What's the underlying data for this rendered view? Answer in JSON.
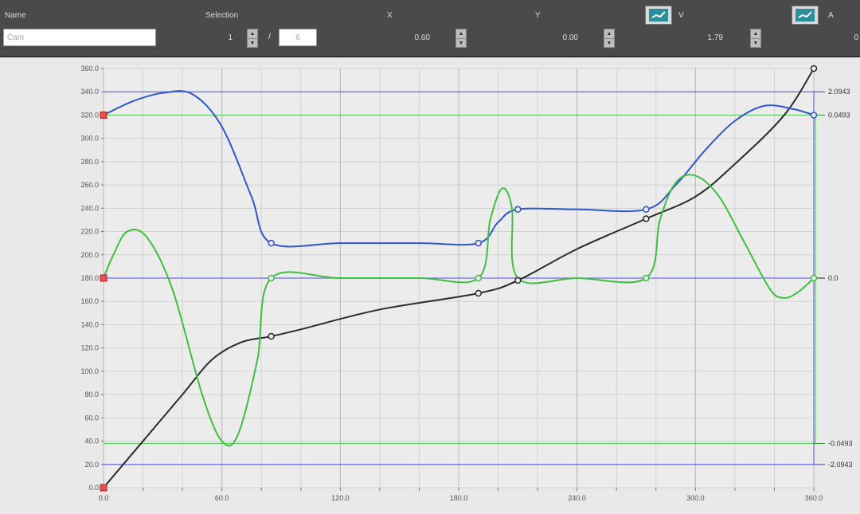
{
  "toolbar": {
    "name_label": "Name",
    "name_value": "Cam",
    "selection_label": "Selection",
    "selection_index": "1",
    "selection_total": "6",
    "x_label": "X",
    "x_value": "0.60",
    "y_label": "Y",
    "y_value": "0.00",
    "v_label": "V",
    "v_value": "1.79",
    "a_label": "A",
    "a_value": "0",
    "slash": "/"
  },
  "chart_data": {
    "type": "line",
    "xlim": [
      0,
      360
    ],
    "ylim": [
      0,
      360
    ],
    "x_ticks": [
      "0.0",
      "60.0",
      "120.0",
      "180.0",
      "240.0",
      "300.0",
      "360.0"
    ],
    "y_ticks": [
      "0.0",
      "20.0",
      "40.0",
      "60.0",
      "80.0",
      "100.0",
      "120.0",
      "140.0",
      "160.0",
      "180.0",
      "200.0",
      "220.0",
      "240.0",
      "260.0",
      "280.0",
      "300.0",
      "320.0",
      "340.0",
      "360.0"
    ],
    "right_labels": [
      {
        "text": "2.0943",
        "y": 340,
        "color": "blue"
      },
      {
        "text": "0.0493",
        "y": 320,
        "color": "green"
      },
      {
        "text": "0.0",
        "y": 180,
        "color": "black"
      },
      {
        "text": "-0.0493",
        "y": 38,
        "color": "green"
      },
      {
        "text": "-2.0943",
        "y": 20,
        "color": "blue"
      }
    ],
    "grid": true,
    "series": [
      {
        "key": "position",
        "color": "#2b2b2b",
        "points": [
          [
            0,
            0
          ],
          [
            20,
            40
          ],
          [
            40,
            80
          ],
          [
            55,
            110
          ],
          [
            70,
            125
          ],
          [
            85,
            130
          ],
          [
            100,
            136
          ],
          [
            140,
            153
          ],
          [
            190,
            167
          ],
          [
            210,
            178
          ],
          [
            240,
            205
          ],
          [
            275,
            231
          ],
          [
            300,
            250
          ],
          [
            320,
            278
          ],
          [
            345,
            320
          ],
          [
            360,
            360
          ]
        ],
        "markers": [
          [
            0,
            0
          ],
          [
            85,
            130
          ],
          [
            190,
            167
          ],
          [
            210,
            178
          ],
          [
            275,
            231
          ],
          [
            360,
            360
          ]
        ]
      },
      {
        "key": "velocity",
        "color": "#2e57c9",
        "points": [
          [
            0,
            320
          ],
          [
            15,
            332
          ],
          [
            30,
            339
          ],
          [
            45,
            338
          ],
          [
            60,
            310
          ],
          [
            75,
            250
          ],
          [
            85,
            210
          ],
          [
            120,
            210
          ],
          [
            160,
            210
          ],
          [
            190,
            210
          ],
          [
            200,
            228
          ],
          [
            210,
            239
          ],
          [
            240,
            239
          ],
          [
            275,
            239
          ],
          [
            290,
            260
          ],
          [
            305,
            290
          ],
          [
            320,
            315
          ],
          [
            335,
            328
          ],
          [
            350,
            325
          ],
          [
            360,
            320
          ]
        ],
        "markers": [
          [
            0,
            320
          ],
          [
            85,
            210
          ],
          [
            190,
            210
          ],
          [
            210,
            239
          ],
          [
            275,
            239
          ],
          [
            360,
            320
          ]
        ]
      },
      {
        "key": "acceleration",
        "color": "#3fbf3f",
        "points": [
          [
            0,
            180
          ],
          [
            5,
            200
          ],
          [
            12,
            220
          ],
          [
            22,
            215
          ],
          [
            35,
            170
          ],
          [
            50,
            80
          ],
          [
            60,
            40
          ],
          [
            68,
            45
          ],
          [
            78,
            110
          ],
          [
            85,
            180
          ],
          [
            120,
            180
          ],
          [
            160,
            180
          ],
          [
            190,
            180
          ],
          [
            196,
            230
          ],
          [
            202,
            257
          ],
          [
            207,
            240
          ],
          [
            210,
            180
          ],
          [
            240,
            180
          ],
          [
            275,
            180
          ],
          [
            282,
            230
          ],
          [
            290,
            262
          ],
          [
            300,
            268
          ],
          [
            312,
            250
          ],
          [
            325,
            210
          ],
          [
            338,
            170
          ],
          [
            345,
            163
          ],
          [
            352,
            168
          ],
          [
            360,
            180
          ]
        ],
        "markers": [
          [
            85,
            180
          ],
          [
            190,
            180
          ],
          [
            275,
            180
          ],
          [
            360,
            180
          ]
        ]
      }
    ],
    "hlines": [
      {
        "y": 340,
        "color": "#6b6bdb"
      },
      {
        "y": 320,
        "color": "#5fcf5f"
      },
      {
        "y": 180,
        "color": "#6b6bdb"
      },
      {
        "y": 38,
        "color": "#5fcf5f"
      },
      {
        "y": 20,
        "color": "#6b6bdb"
      }
    ],
    "red_markers": [
      [
        0,
        320
      ],
      [
        0,
        180
      ],
      [
        0,
        0
      ]
    ]
  }
}
